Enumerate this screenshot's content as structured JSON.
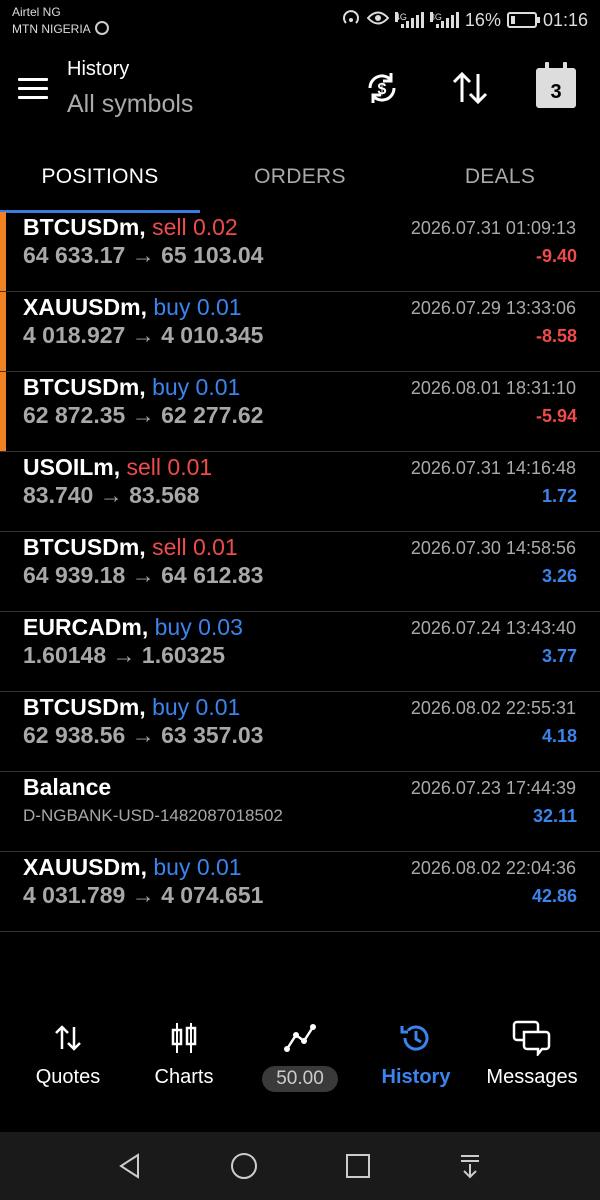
{
  "status_bar": {
    "carrier_1": "Airtel NG",
    "carrier_2": "MTN NIGERIA",
    "battery": "16%",
    "time": "01:16",
    "sig1_label": "4G",
    "sig2_label": "3G"
  },
  "header": {
    "title": "History",
    "subtitle": "All symbols",
    "calendar_day": "3"
  },
  "tabs": [
    {
      "label": "POSITIONS",
      "active": true
    },
    {
      "label": "ORDERS",
      "active": false
    },
    {
      "label": "DEALS",
      "active": false
    }
  ],
  "rows": [
    {
      "symbol": "BTCUSDm,",
      "side": "sell 0.02",
      "prices": "64 633.17 → 65 103.04",
      "datetime": "2026.07.31 01:09:13",
      "profit": "-9.40"
    },
    {
      "symbol": "XAUUSDm,",
      "side": "buy 0.01",
      "prices": "4 018.927 → 4 010.345",
      "datetime": "2026.07.29 13:33:06",
      "profit": "-8.58"
    },
    {
      "symbol": "BTCUSDm,",
      "side": "buy 0.01",
      "prices": "62 872.35 → 62 277.62",
      "datetime": "2026.08.01 18:31:10",
      "profit": "-5.94"
    },
    {
      "symbol": "USOILm,",
      "side": "sell 0.01",
      "prices": "83.740 → 83.568",
      "datetime": "2026.07.31 14:16:48",
      "profit": "1.72"
    },
    {
      "symbol": "BTCUSDm,",
      "side": "sell 0.01",
      "prices": "64 939.18 → 64 612.83",
      "datetime": "2026.07.30 14:58:56",
      "profit": "3.26"
    },
    {
      "symbol": "EURCADm,",
      "side": "buy 0.03",
      "prices": "1.60148 → 1.60325",
      "datetime": "2026.07.24 13:43:40",
      "profit": "3.77"
    },
    {
      "symbol": "BTCUSDm,",
      "side": "buy 0.01",
      "prices": "62 938.56 → 63 357.03",
      "datetime": "2026.08.02 22:55:31",
      "profit": "4.18"
    },
    {
      "symbol": "Balance",
      "side": "",
      "subline": "D-NGBANK-USD-1482087018502",
      "datetime": "2026.07.23 17:44:39",
      "profit": "32.11"
    },
    {
      "symbol": "XAUUSDm,",
      "side": "buy 0.01",
      "prices": "4 031.789 → 4 074.651",
      "datetime": "2026.08.02 22:04:36",
      "profit": "42.86"
    }
  ],
  "bottom_nav": {
    "quotes": "Quotes",
    "charts": "Charts",
    "trade_value": "50.00",
    "history": "History",
    "messages": "Messages"
  },
  "colors": {
    "sell": "#ef4b4b",
    "buy": "#3b84ee",
    "loss_marker": "#f08020",
    "accent": "#3b7ddd"
  },
  "battery_level": 0.16
}
